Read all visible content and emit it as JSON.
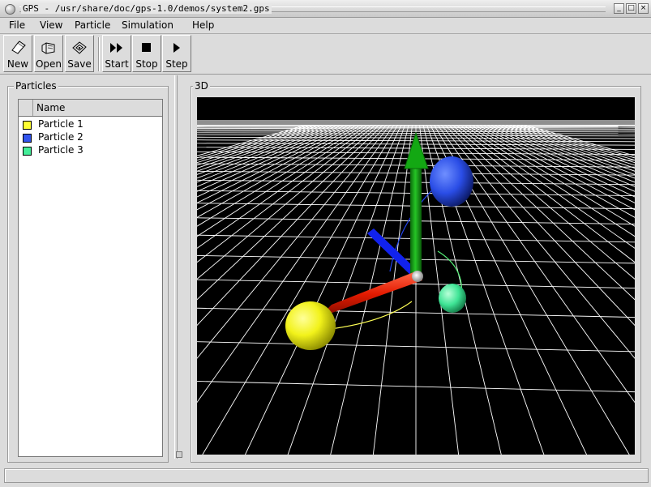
{
  "window": {
    "title": "GPS - /usr/share/doc/gps-1.0/demos/system2.gps",
    "buttons": {
      "minimize": "_",
      "maximize": "□",
      "close": "×"
    }
  },
  "menu": [
    "File",
    "View",
    "Particle",
    "Simulation",
    "Help"
  ],
  "toolbar": {
    "new": {
      "label": "New",
      "icon": "new-document-icon"
    },
    "open": {
      "label": "Open",
      "icon": "open-folder-icon"
    },
    "save": {
      "label": "Save",
      "icon": "save-disk-icon"
    },
    "start": {
      "label": "Start",
      "icon": "fast-forward-icon"
    },
    "stop": {
      "label": "Stop",
      "icon": "stop-icon"
    },
    "step": {
      "label": "Step",
      "icon": "play-step-icon"
    }
  },
  "particles_panel": {
    "title": "Particles",
    "column_header": "Name",
    "items": [
      {
        "name": "Particle 1",
        "color": "#ffff33"
      },
      {
        "name": "Particle 2",
        "color": "#3355ee"
      },
      {
        "name": "Particle 3",
        "color": "#44ee99"
      }
    ]
  },
  "view_panel": {
    "title": "3D",
    "background": "#000000",
    "grid_color": "#ffffff",
    "axes_colors": {
      "x": "#ee2200",
      "y": "#11aa11",
      "z": "#1122ee"
    },
    "spheres": [
      {
        "particle": "Particle 1",
        "color": "#ffff33",
        "trail_color": "#ffff55"
      },
      {
        "particle": "Particle 2",
        "color": "#3355ee",
        "trail_color": "#2244ee"
      },
      {
        "particle": "Particle 3",
        "color": "#44ee99",
        "trail_color": "#55ee77"
      }
    ]
  },
  "statusbar": {
    "text": ""
  }
}
